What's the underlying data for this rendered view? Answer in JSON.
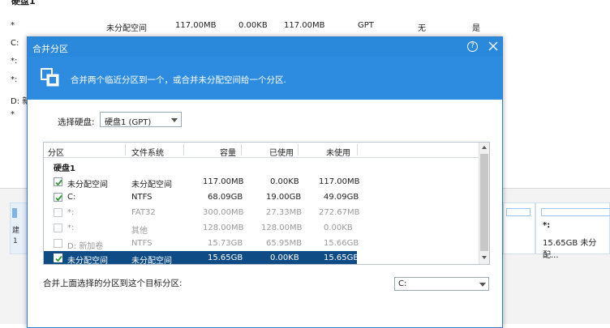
{
  "background": {
    "disk_title": "硬盘1",
    "rows": [
      {
        "label": "*",
        "name": "未分配空间",
        "capacity": "117.00MB",
        "used": "0.00KB",
        "free": "117.00MB",
        "type": "GPT",
        "status": "无",
        "flag": "是"
      },
      {
        "label": "C:"
      },
      {
        "label": "*:"
      },
      {
        "label": "*:"
      },
      {
        "label": "D: 新"
      },
      {
        "label": "*"
      }
    ],
    "left_stub": {
      "line1": "建",
      "line2": "1"
    },
    "right_card": {
      "label": "*:",
      "size": "15.65GB 未分配..."
    }
  },
  "dialog": {
    "title": "合并分区",
    "help_symbol": "?",
    "banner_text": "合并两个临近分区到一个，或合并未分配空间给一个分区.",
    "disk_label": "选择硬盘:",
    "disk_value": "硬盘1 (GPT)",
    "table": {
      "headers": [
        "分区",
        "文件系统",
        "容量",
        "已使用",
        "未使用"
      ],
      "group": "硬盘1",
      "rows": [
        {
          "name": "未分配空间",
          "fs": "未分配空间",
          "capacity": "117.00MB",
          "used": "0.00KB",
          "free": "117.00MB",
          "checked": true,
          "enabled": true,
          "selected": false
        },
        {
          "name": "C:",
          "fs": "NTFS",
          "capacity": "68.09GB",
          "used": "19.00GB",
          "free": "49.09GB",
          "checked": true,
          "enabled": true,
          "selected": false
        },
        {
          "name": "*:",
          "fs": "FAT32",
          "capacity": "300.00MB",
          "used": "27.33MB",
          "free": "272.67MB",
          "checked": false,
          "enabled": false,
          "selected": false
        },
        {
          "name": "*:",
          "fs": "其他",
          "capacity": "128.00MB",
          "used": "128.00MB",
          "free": "0.00KB",
          "checked": false,
          "enabled": false,
          "selected": false
        },
        {
          "name": "D: 新加卷",
          "fs": "NTFS",
          "capacity": "15.73GB",
          "used": "65.95MB",
          "free": "15.66GB",
          "checked": false,
          "enabled": false,
          "selected": false
        },
        {
          "name": "未分配空间",
          "fs": "未分配空间",
          "capacity": "15.65GB",
          "used": "0.00KB",
          "free": "15.65GB",
          "checked": true,
          "enabled": true,
          "selected": true
        }
      ]
    },
    "merge_label": "合并上面选择的分区到这个目标分区:",
    "target_value": "C:"
  },
  "colors": {
    "titlebar": "#2b89db",
    "banner": "#2e8ce0",
    "selected_row": "#0f4c86",
    "check": "#2f9a34"
  }
}
